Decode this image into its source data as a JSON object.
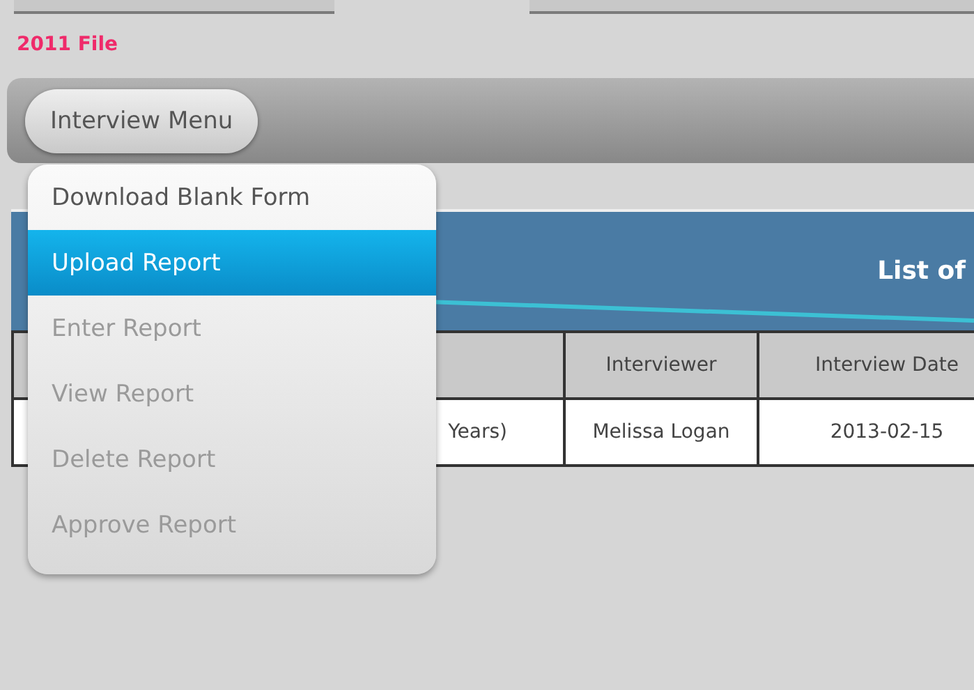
{
  "file_label": "2011 File",
  "toolbar": {
    "menu_button": "Interview Menu"
  },
  "menu": [
    {
      "label": "Download Blank Form",
      "selected": false,
      "disabled": false
    },
    {
      "label": "Upload Report",
      "selected": true,
      "disabled": false
    },
    {
      "label": "Enter Report",
      "selected": false,
      "disabled": true
    },
    {
      "label": "View Report",
      "selected": false,
      "disabled": true
    },
    {
      "label": "Delete Report",
      "selected": false,
      "disabled": true
    },
    {
      "label": "Approve Report",
      "selected": false,
      "disabled": true
    }
  ],
  "panel": {
    "title": "List of"
  },
  "table": {
    "columns": [
      "",
      "Interviewer",
      "Interview Date"
    ],
    "rows": [
      [
        "Years)",
        "Melissa Logan",
        "2013-02-15"
      ]
    ]
  }
}
